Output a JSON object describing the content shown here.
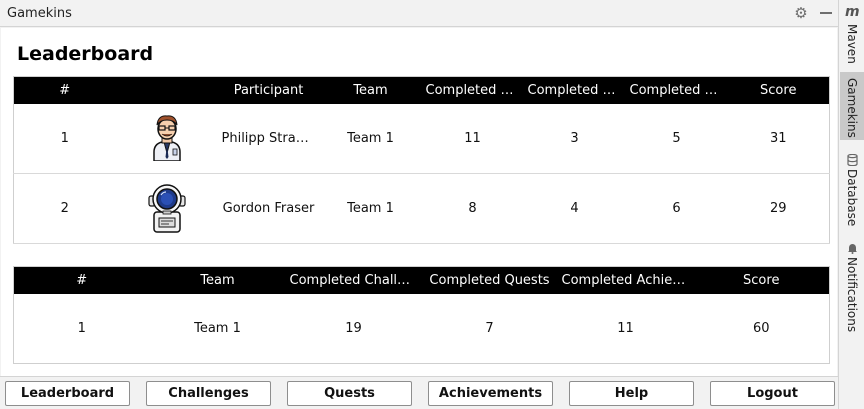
{
  "window": {
    "title": "Gamekins"
  },
  "stripe": {
    "logo": "m",
    "items": [
      {
        "label": "Maven"
      },
      {
        "label": "Gamekins"
      },
      {
        "label": "Database"
      },
      {
        "label": "Notifications"
      }
    ]
  },
  "leaderboard": {
    "title": "Leaderboard",
    "participants": {
      "headers": [
        "#",
        "",
        "Participant",
        "Team",
        "Completed C...",
        "Completed Q...",
        "Completed A...",
        "Score"
      ],
      "rows": [
        {
          "rank": "1",
          "avatar": "avatar-glasses-man",
          "name": "Philipp Strau...",
          "team": "Team 1",
          "challenges": "11",
          "quests": "3",
          "achievements": "5",
          "score": "31"
        },
        {
          "rank": "2",
          "avatar": "avatar-astronaut",
          "name": "Gordon Fraser",
          "team": "Team 1",
          "challenges": "8",
          "quests": "4",
          "achievements": "6",
          "score": "29"
        }
      ]
    },
    "teams": {
      "headers": [
        "#",
        "Team",
        "Completed Challen...",
        "Completed Quests",
        "Completed Achiev...",
        "Score"
      ],
      "rows": [
        {
          "rank": "1",
          "team": "Team 1",
          "challenges": "19",
          "quests": "7",
          "achievements": "11",
          "score": "60"
        }
      ]
    }
  },
  "nav": {
    "buttons": [
      "Leaderboard",
      "Challenges",
      "Quests",
      "Achievements",
      "Help",
      "Logout"
    ]
  }
}
